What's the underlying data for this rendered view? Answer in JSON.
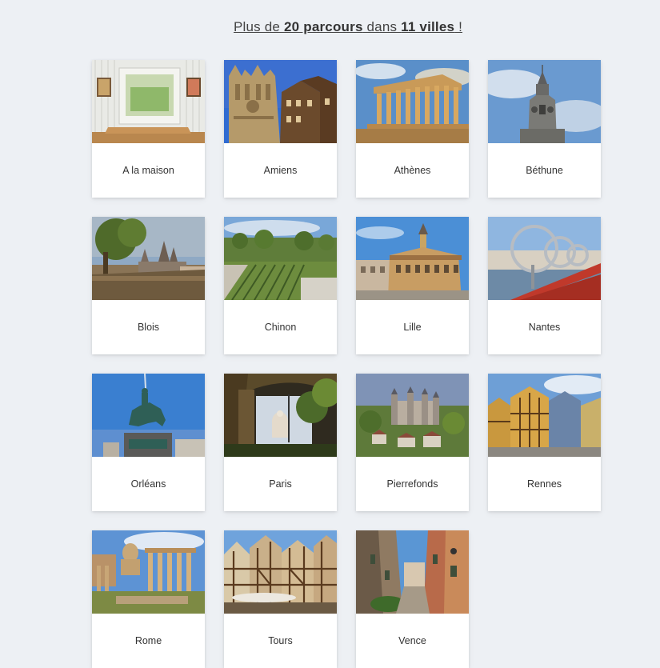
{
  "headline": {
    "prefix": "Plus de ",
    "routes_count": "20 parcours",
    "middle": " dans ",
    "cities_count": "11 villes",
    "suffix": " !"
  },
  "cities": [
    {
      "label": "A la maison",
      "image": "home-interior-image"
    },
    {
      "label": "Amiens",
      "image": "amiens-cathedral-image"
    },
    {
      "label": "Athènes",
      "image": "parthenon-image"
    },
    {
      "label": "Béthune",
      "image": "bethune-belfry-image"
    },
    {
      "label": "Blois",
      "image": "blois-view-image"
    },
    {
      "label": "Chinon",
      "image": "chinon-vineyard-image"
    },
    {
      "label": "Lille",
      "image": "lille-grand-place-image"
    },
    {
      "label": "Nantes",
      "image": "nantes-rings-image"
    },
    {
      "label": "Orléans",
      "image": "joan-of-arc-statue-image"
    },
    {
      "label": "Paris",
      "image": "sacre-coeur-image"
    },
    {
      "label": "Pierrefonds",
      "image": "pierrefonds-castle-image"
    },
    {
      "label": "Rennes",
      "image": "rennes-timber-houses-image"
    },
    {
      "label": "Rome",
      "image": "roman-forum-image"
    },
    {
      "label": "Tours",
      "image": "tours-timber-houses-image"
    },
    {
      "label": "Vence",
      "image": "vence-street-image"
    }
  ],
  "colors": {
    "background": "#edf0f4",
    "card": "#ffffff",
    "text": "#333333"
  }
}
